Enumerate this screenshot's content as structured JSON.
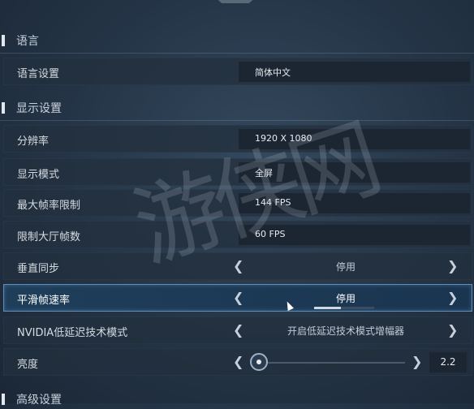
{
  "sections": {
    "language": "语言",
    "display": "显示设置",
    "advanced": "高级设置"
  },
  "rows": {
    "language_setting": {
      "label": "语言设置",
      "value": "简体中文"
    },
    "resolution": {
      "label": "分辨率",
      "value": "1920 X 1080"
    },
    "display_mode": {
      "label": "显示模式",
      "value": "全屏"
    },
    "max_fps": {
      "label": "最大帧率限制",
      "value": "144 FPS"
    },
    "lobby_fps": {
      "label": "限制大厅帧数",
      "value": "60 FPS"
    },
    "vsync": {
      "label": "垂直同步",
      "value": "停用"
    },
    "smooth_fps": {
      "label": "平滑帧速率",
      "value": "停用",
      "progress": 0.45
    },
    "nvidia_reflex": {
      "label": "NVIDIA低延迟技术模式",
      "value": "开启低延迟技术模式增幅器"
    },
    "brightness": {
      "label": "亮度",
      "value": "2.2"
    }
  },
  "watermark": "游侠网",
  "icons": {
    "left_arrow": "chevron-left-icon",
    "right_arrow": "chevron-right-icon",
    "cursor": "mouse-cursor-icon"
  },
  "colors": {
    "active_border": "#5f8fb7",
    "row_bg": "#222f3e"
  }
}
